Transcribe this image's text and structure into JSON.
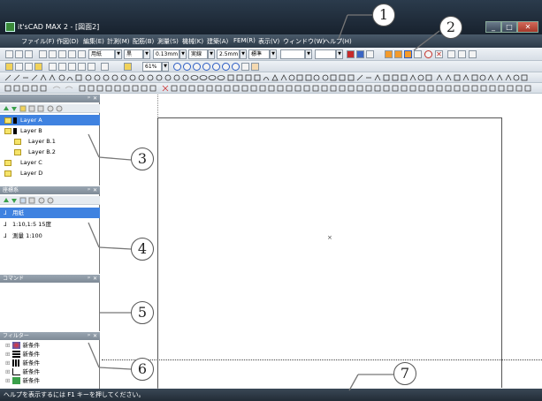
{
  "window": {
    "title": "it'sCAD MAX 2 - [図面2]",
    "min": "_",
    "max": "□",
    "close": "✕"
  },
  "menu": [
    "ファイル(F)",
    "作図(D)",
    "編集(E)",
    "計測(M)",
    "配筋(B)",
    "測量(S)",
    "機械(K)",
    "建築(A)",
    "FEM(R)",
    "表示(V)",
    "ウィンドウ(W)",
    "ヘルプ(H)"
  ],
  "toolbar": {
    "paper": "用紙",
    "color": "黒",
    "linewidth": "0.13mm",
    "linetype": "実線",
    "textsize": "2.5mm",
    "textstyle": "標準",
    "zoom": "61%"
  },
  "layers_panel": {
    "title": "",
    "items": [
      {
        "label": "Layer A",
        "indent": 0,
        "selected": true
      },
      {
        "label": "Layer B",
        "indent": 0,
        "selected": false
      },
      {
        "label": "Layer B.1",
        "indent": 1,
        "selected": false
      },
      {
        "label": "Layer B.2",
        "indent": 1,
        "selected": false
      },
      {
        "label": "Layer C",
        "indent": 0,
        "selected": false
      },
      {
        "label": "Layer D",
        "indent": 0,
        "selected": false
      }
    ]
  },
  "coord_panel": {
    "title": "座標系",
    "items": [
      {
        "label": "用紙",
        "selected": true
      },
      {
        "label": "1:10,1:5 15度",
        "selected": false
      },
      {
        "label": "測量 1:100",
        "selected": false
      }
    ]
  },
  "command_panel": {
    "title": "コマンド"
  },
  "filter_panel": {
    "title": "フィルター",
    "items": [
      "新条件",
      "新条件",
      "新条件",
      "新条件",
      "新条件"
    ]
  },
  "status": "ヘルプを表示するには F1 キーを押してください。",
  "callouts": [
    "1",
    "2",
    "3",
    "4",
    "5",
    "6",
    "7"
  ],
  "colors": {
    "selection": "#3f82e0",
    "titlebar": "#1f2b38"
  }
}
